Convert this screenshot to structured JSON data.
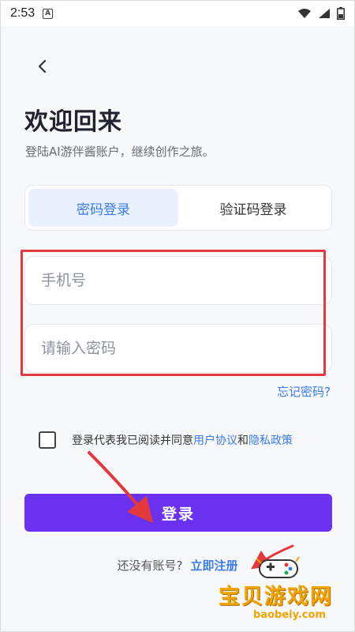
{
  "status_bar": {
    "time": "2:53",
    "notification_icon": "A"
  },
  "header": {
    "back_icon": "chevron-left-icon",
    "title": "欢迎回来",
    "subtitle": "登陆AI游伴酱账户，继续创作之旅。"
  },
  "tabs": [
    {
      "label": "密码登录",
      "active": true
    },
    {
      "label": "验证码登录",
      "active": false
    }
  ],
  "form": {
    "phone_placeholder": "手机号",
    "password_placeholder": "请输入密码",
    "forgot_label": "忘记密码?"
  },
  "agreement": {
    "prefix": "登录代表我已阅读并同意",
    "user_agreement": "用户协议",
    "and": "和",
    "privacy_policy": "隐私政策",
    "checked": false
  },
  "login_button": "登录",
  "register": {
    "prompt": "还没有账号?",
    "link": "立即注册"
  },
  "watermark": {
    "text": "宝贝游戏网",
    "url": "baobeiy.com"
  },
  "colors": {
    "accent": "#6a32f0",
    "link": "#3a7bea",
    "annotation": "#e4393c"
  }
}
